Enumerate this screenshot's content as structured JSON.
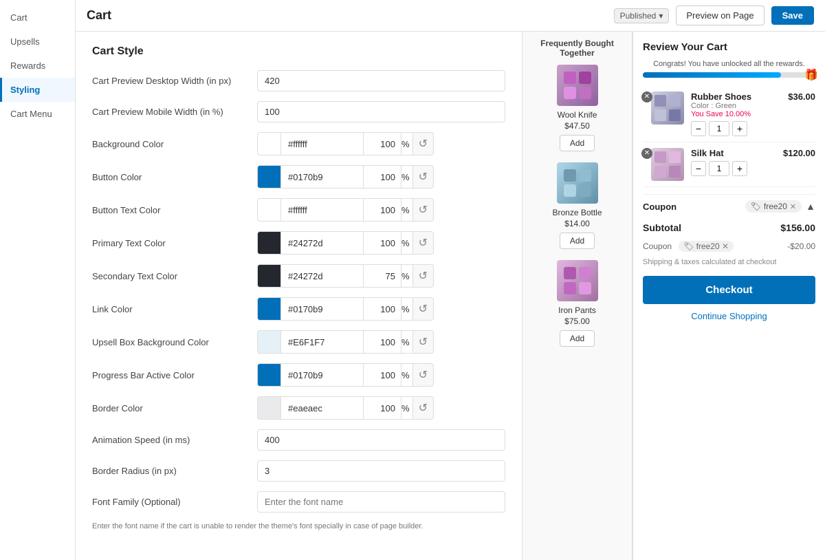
{
  "app": {
    "title": "Cart",
    "published_label": "Published",
    "preview_button": "Preview on Page",
    "save_button": "Save"
  },
  "sidebar": {
    "items": [
      {
        "id": "cart",
        "label": "Cart"
      },
      {
        "id": "upsells",
        "label": "Upsells"
      },
      {
        "id": "rewards",
        "label": "Rewards"
      },
      {
        "id": "styling",
        "label": "Styling"
      },
      {
        "id": "cart-menu",
        "label": "Cart Menu"
      }
    ],
    "active": "styling"
  },
  "cart_style": {
    "section_title": "Cart Style",
    "fields": [
      {
        "id": "desktop_width",
        "label": "Cart Preview Desktop Width (in px)",
        "value": "420"
      },
      {
        "id": "mobile_width",
        "label": "Cart Preview Mobile Width (in %)",
        "value": "100"
      },
      {
        "id": "animation_speed",
        "label": "Animation Speed (in ms)",
        "value": "400"
      },
      {
        "id": "border_radius",
        "label": "Border Radius (in px)",
        "value": "3"
      },
      {
        "id": "font_family",
        "label": "Font Family (Optional)",
        "value": "",
        "placeholder": "Enter the font name"
      }
    ],
    "color_fields": [
      {
        "id": "background_color",
        "label": "Background Color",
        "swatch": "#ffffff",
        "hex": "#ffffff",
        "opacity": "100"
      },
      {
        "id": "button_color",
        "label": "Button Color",
        "swatch": "#0170b9",
        "hex": "#0170b9",
        "opacity": "100"
      },
      {
        "id": "button_text_color",
        "label": "Button Text Color",
        "swatch": "#ffffff",
        "hex": "#ffffff",
        "opacity": "100"
      },
      {
        "id": "primary_text_color",
        "label": "Primary Text Color",
        "swatch": "#24272d",
        "hex": "#24272d",
        "opacity": "100"
      },
      {
        "id": "secondary_text_color",
        "label": "Secondary Text Color",
        "swatch": "#24272d",
        "hex": "#24272d",
        "opacity": "75"
      },
      {
        "id": "link_color",
        "label": "Link Color",
        "swatch": "#0170b9",
        "hex": "#0170b9",
        "opacity": "100"
      },
      {
        "id": "upsell_box_bg_color",
        "label": "Upsell Box Background Color",
        "swatch": "#e6f1f7",
        "hex": "#E6F1F7",
        "opacity": "100"
      },
      {
        "id": "progress_bar_color",
        "label": "Progress Bar Active Color",
        "swatch": "#0170b9",
        "hex": "#0170b9",
        "opacity": "100"
      },
      {
        "id": "border_color",
        "label": "Border Color",
        "swatch": "#eaeaec",
        "hex": "#eaeaec",
        "opacity": "100"
      }
    ],
    "font_hint": "Enter the font name if the cart is unable to render the theme's font specially in case of page builder."
  },
  "frequently_bought": {
    "title": "Frequently Bought Together",
    "items": [
      {
        "id": "wool-knife",
        "name": "Wool Knife",
        "price": "$47.50",
        "add_label": "Add"
      },
      {
        "id": "bronze-bottle",
        "name": "Bronze Bottle",
        "price": "$14.00",
        "add_label": "Add"
      },
      {
        "id": "iron-pants",
        "name": "Iron Pants",
        "price": "$75.00",
        "add_label": "Add"
      }
    ]
  },
  "review_cart": {
    "title": "Review Your Cart",
    "progress_text": "Congrats! You have unlocked all the rewards.",
    "progress_value": 80,
    "items": [
      {
        "id": "rubber-shoes",
        "name": "Rubber Shoes",
        "sub": "Color : Green",
        "save": "You Save 10.00%",
        "price": "$36.00",
        "qty": 1
      },
      {
        "id": "silk-hat",
        "name": "Silk Hat",
        "sub": "",
        "save": "",
        "price": "$120.00",
        "qty": 1
      }
    ],
    "coupon_section": {
      "label": "Coupon",
      "coupon_code": "free20",
      "collapse_icon": "▲"
    },
    "subtotal_label": "Subtotal",
    "subtotal_value": "$156.00",
    "discount_label": "Coupon",
    "discount_code": "free20",
    "discount_value": "-$20.00",
    "shipping_note": "Shipping & taxes calculated at checkout",
    "checkout_button": "Checkout",
    "continue_shopping": "Continue Shopping"
  }
}
